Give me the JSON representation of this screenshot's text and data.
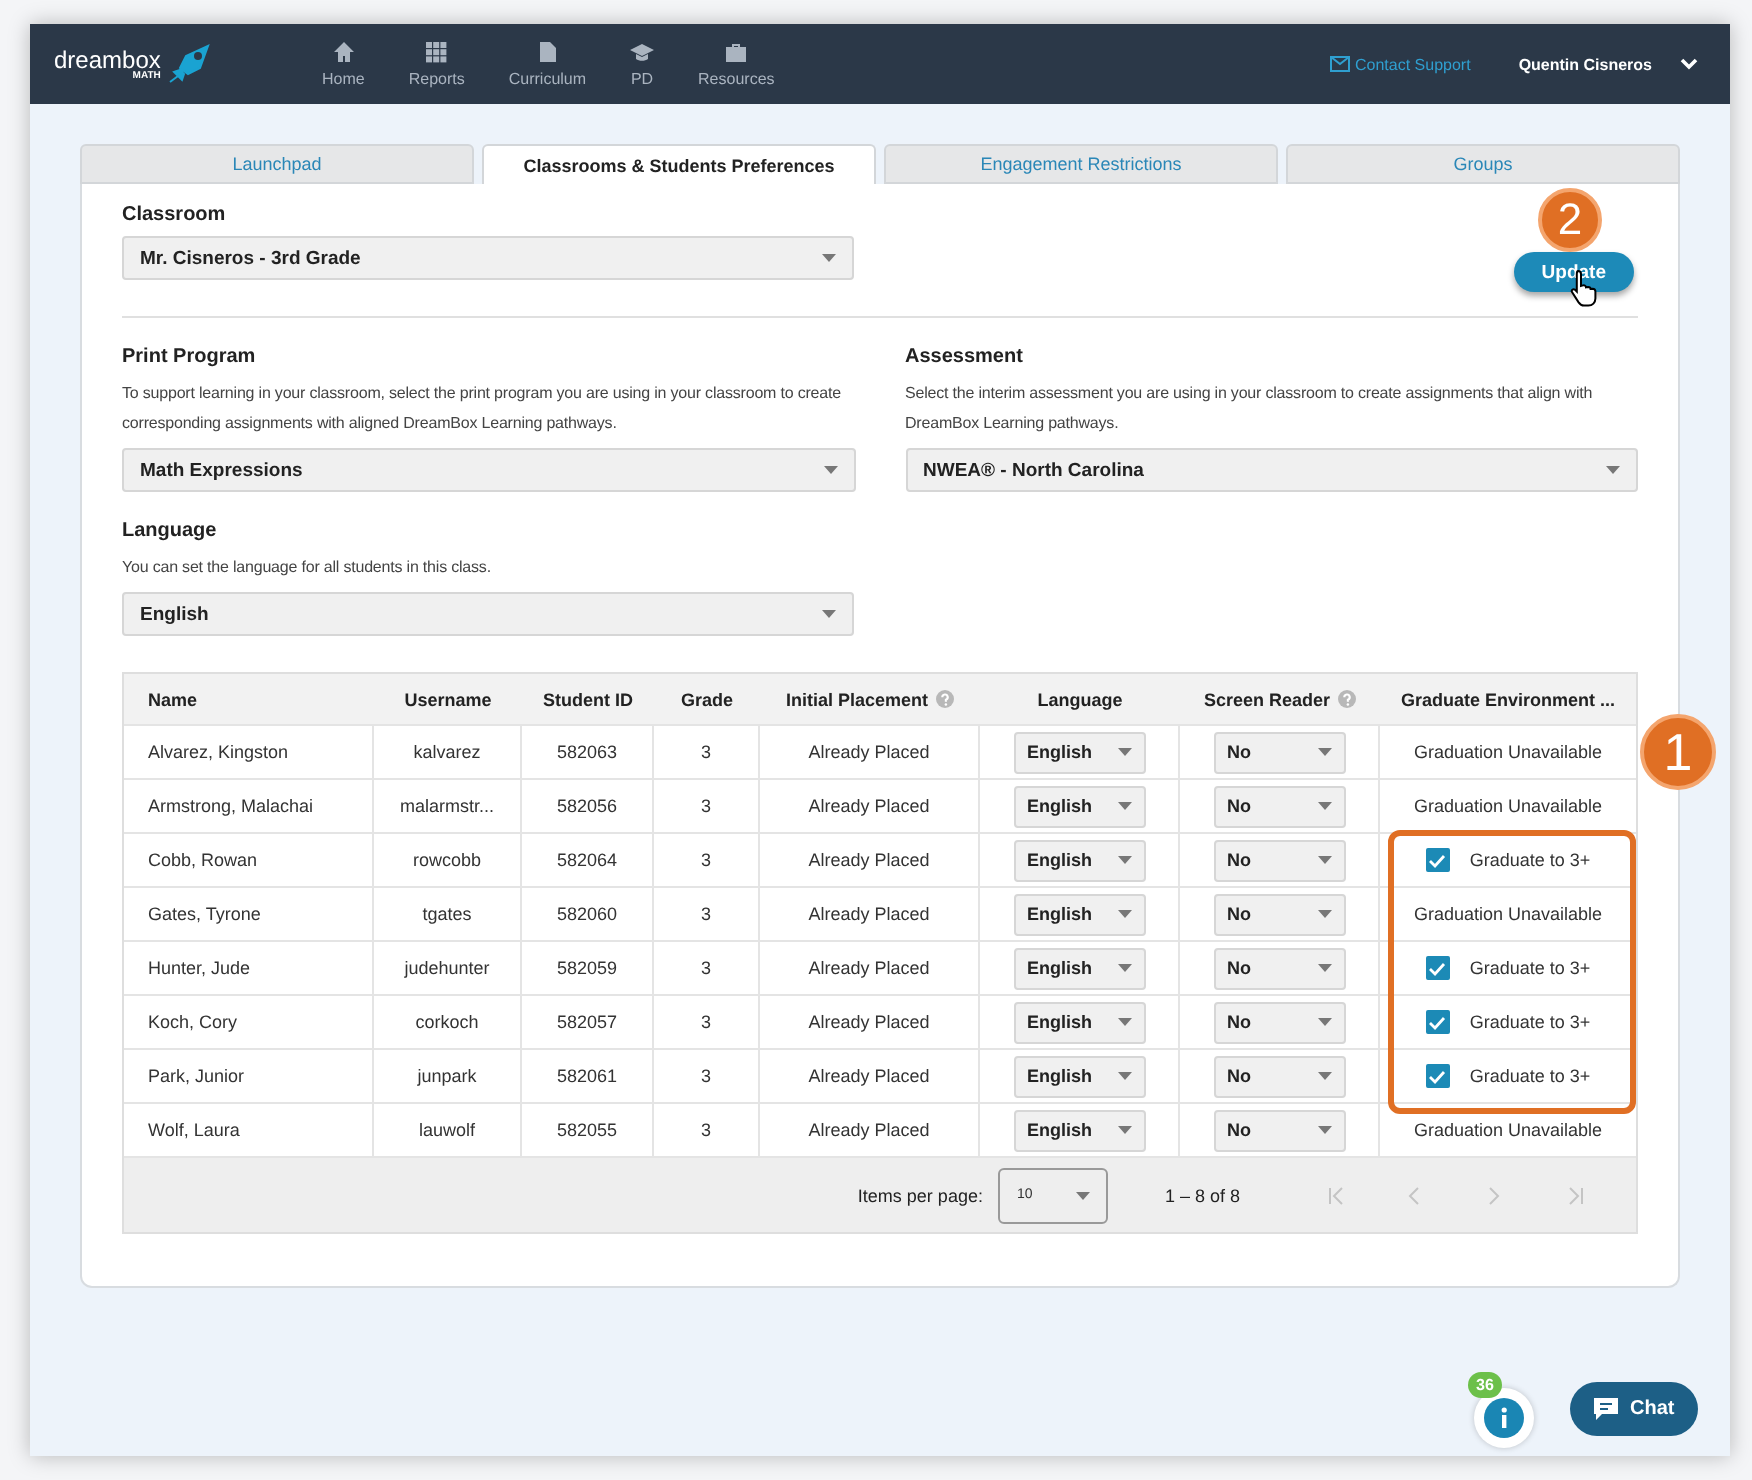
{
  "brand": {
    "name": "dreambox",
    "sub": "MATH"
  },
  "nav": [
    {
      "label": "Home"
    },
    {
      "label": "Reports"
    },
    {
      "label": "Curriculum"
    },
    {
      "label": "PD"
    },
    {
      "label": "Resources"
    }
  ],
  "contact": "Contact Support",
  "user": "Quentin Cisneros",
  "tabs": [
    {
      "label": "Launchpad",
      "selected": false
    },
    {
      "label": "Classrooms & Students Preferences",
      "selected": true
    },
    {
      "label": "Engagement Restrictions",
      "selected": false
    },
    {
      "label": "Groups",
      "selected": false
    }
  ],
  "classroom": {
    "label": "Classroom",
    "value": "Mr. Cisneros - 3rd Grade"
  },
  "update_button": "Update",
  "print_program": {
    "label": "Print Program",
    "description": "To support learning in your classroom, select the print program you are using in your classroom to create corresponding assignments with aligned DreamBox Learning pathways.",
    "value": "Math Expressions"
  },
  "assessment": {
    "label": "Assessment",
    "description": "Select the interim assessment you are using in your classroom to create assignments that align with DreamBox Learning pathways.",
    "value": "NWEA® - North Carolina"
  },
  "language": {
    "label": "Language",
    "description": "You can set the language for all students in this class.",
    "value": "English"
  },
  "table": {
    "columns": [
      {
        "label": "Name",
        "help": false
      },
      {
        "label": "Username",
        "help": false
      },
      {
        "label": "Student ID",
        "help": false
      },
      {
        "label": "Grade",
        "help": false
      },
      {
        "label": "Initial Placement",
        "help": true
      },
      {
        "label": "Language",
        "help": false
      },
      {
        "label": "Screen Reader",
        "help": true
      },
      {
        "label": "Graduate Environment ...",
        "help": false
      }
    ],
    "rows": [
      {
        "name": "Alvarez, Kingston",
        "username": "kalvarez",
        "id": "582063",
        "grade": "3",
        "placement": "Already Placed",
        "language": "English",
        "screen_reader": "No",
        "graduate": {
          "kind": "text",
          "label": "Graduation Unavailable"
        }
      },
      {
        "name": "Armstrong, Malachai",
        "username": "malarmstr...",
        "id": "582056",
        "grade": "3",
        "placement": "Already Placed",
        "language": "English",
        "screen_reader": "No",
        "graduate": {
          "kind": "text",
          "label": "Graduation Unavailable"
        }
      },
      {
        "name": "Cobb, Rowan",
        "username": "rowcobb",
        "id": "582064",
        "grade": "3",
        "placement": "Already Placed",
        "language": "English",
        "screen_reader": "No",
        "graduate": {
          "kind": "checkbox",
          "label": "Graduate to 3+",
          "checked": true
        }
      },
      {
        "name": "Gates, Tyrone",
        "username": "tgates",
        "id": "582060",
        "grade": "3",
        "placement": "Already Placed",
        "language": "English",
        "screen_reader": "No",
        "graduate": {
          "kind": "text",
          "label": "Graduation Unavailable"
        }
      },
      {
        "name": "Hunter, Jude",
        "username": "judehunter",
        "id": "582059",
        "grade": "3",
        "placement": "Already Placed",
        "language": "English",
        "screen_reader": "No",
        "graduate": {
          "kind": "checkbox",
          "label": "Graduate to 3+",
          "checked": true
        }
      },
      {
        "name": "Koch, Cory",
        "username": "corkoch",
        "id": "582057",
        "grade": "3",
        "placement": "Already Placed",
        "language": "English",
        "screen_reader": "No",
        "graduate": {
          "kind": "checkbox",
          "label": "Graduate to 3+",
          "checked": true
        }
      },
      {
        "name": "Park, Junior",
        "username": "junpark",
        "id": "582061",
        "grade": "3",
        "placement": "Already Placed",
        "language": "English",
        "screen_reader": "No",
        "graduate": {
          "kind": "checkbox",
          "label": "Graduate to 3+",
          "checked": true
        }
      },
      {
        "name": "Wolf, Laura",
        "username": "lauwolf",
        "id": "582055",
        "grade": "3",
        "placement": "Already Placed",
        "language": "English",
        "screen_reader": "No",
        "graduate": {
          "kind": "text",
          "label": "Graduation Unavailable"
        }
      }
    ]
  },
  "pager": {
    "label": "Items per page:",
    "size": "10",
    "range": "1 – 8 of 8"
  },
  "callouts": [
    "1",
    "2"
  ],
  "notifications": "36",
  "chat": "Chat"
}
